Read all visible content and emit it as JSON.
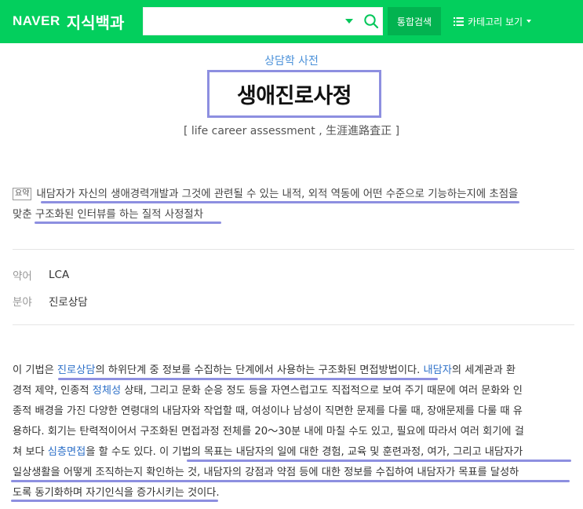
{
  "header": {
    "brand_naver": "NAVER",
    "brand_service": "지식백과",
    "search_value": "",
    "total_search_label": "통합검색",
    "category_label": "카테고리 보기"
  },
  "entry": {
    "dictionary": "상담학 사전",
    "title": "생애진로사정",
    "subtitle": "[ life career assessment , 生涯進路査正 ]"
  },
  "summary": {
    "badge": "요약",
    "line1": "내담자가 자신의 생애경력개발과 그것에 관련될 수 있는 내적, 외적 역동에 어떤 수준으로 기능하는지에 초점을",
    "line2": "맞춘 구조화된 인터뷰를 하는 질적 사정절차"
  },
  "info": [
    {
      "label": "약어",
      "value": "LCA"
    },
    {
      "label": "분야",
      "value": "진로상담"
    }
  ],
  "body": {
    "l1_a": "이 기법은 ",
    "l1_link1": "진로상담",
    "l1_b": "의 하위단계 중 정보를 수집하는 단계에서 사용하는 구조화된 면접방법이다. ",
    "l1_link2": "내담자",
    "l1_c": "의 세계관과 환",
    "l2_a": "경적 제약, 인종적 ",
    "l2_link": "정체성",
    "l2_b": " 상태, 그리고 문화 순응 정도 등을 자연스럽고도 직접적으로 보여 주기 때문에 여러 문화와 인",
    "l3": "종적 배경을 가진 다양한 연령대의 내담자와 작업할 때, 여성이나 남성이 직면한 문제를 다룰 때, 장애문제를 다룰 때 유",
    "l4": "용하다. 회기는 탄력적이어서 구조화된 면접과정 전체를 20～30분 내에 마칠 수도 있고, 필요에 따라서 여러 회기에 걸",
    "l5_a": "쳐 보다 ",
    "l5_link": "심층면접",
    "l5_b": "을 할 수도 있다. 이 기법의 목표는 내담자의 일에 대한 경험, 교육 및 훈련과정, 여가, 그리고 내담자가",
    "l6": "일상생활을 어떻게 조직하는지 확인하는 것, 내담자의 강점과 약점 등에 대한 정보를 수집하여 내담자가 목표를 달성하",
    "l7": "도록 동기화하며 자기인식을 증가시키는 것이다."
  }
}
